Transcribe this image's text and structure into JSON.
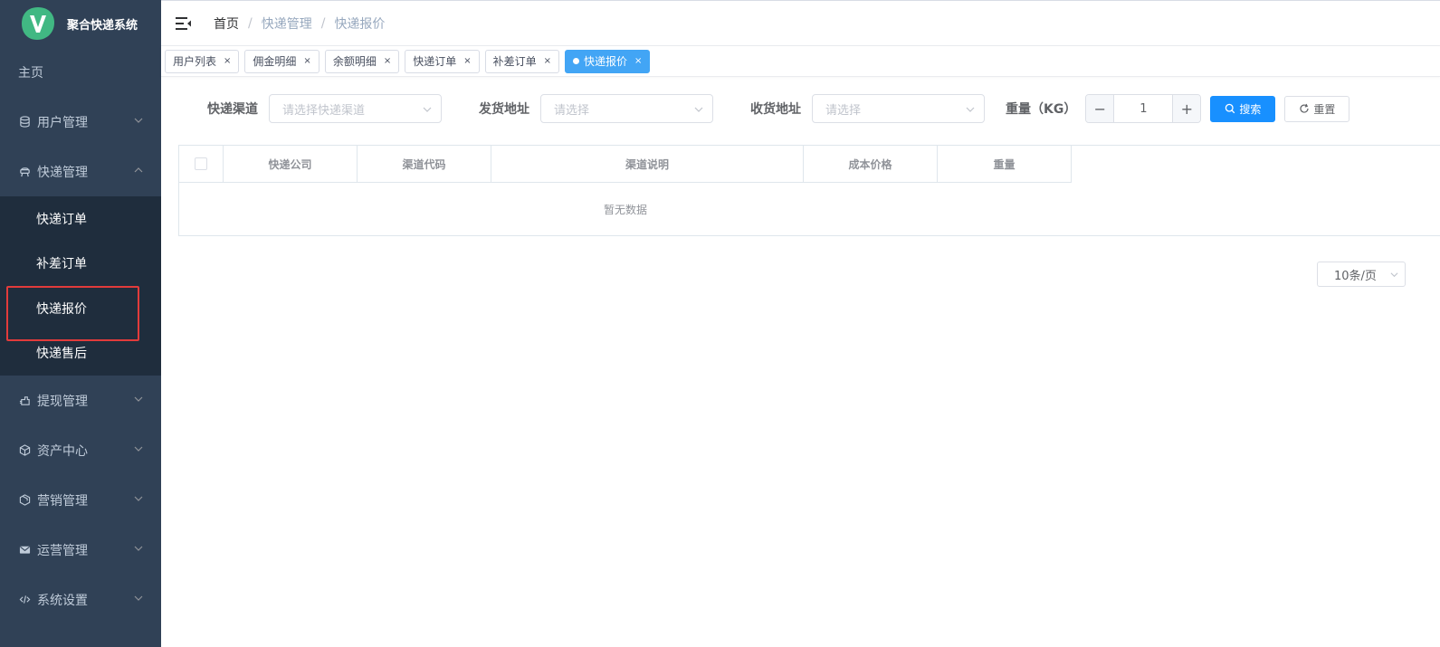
{
  "app": {
    "title": "聚合快递系统",
    "logo_letter": "V",
    "logo_color": "#41b883"
  },
  "sidebar": {
    "home": "主页",
    "items": [
      {
        "label": "用户管理",
        "icon": "database-icon"
      },
      {
        "label": "快递管理",
        "icon": "courier-icon",
        "expanded": true
      },
      {
        "label": "提现管理",
        "icon": "withdraw-icon"
      },
      {
        "label": "资产中心",
        "icon": "cube-icon"
      },
      {
        "label": "营销管理",
        "icon": "box-icon"
      },
      {
        "label": "运营管理",
        "icon": "mail-icon"
      },
      {
        "label": "系统设置",
        "icon": "code-icon"
      }
    ],
    "sub_items": [
      {
        "label": "快递订单"
      },
      {
        "label": "补差订单"
      },
      {
        "label": "快递报价",
        "active": true
      },
      {
        "label": "快递售后"
      }
    ],
    "bg_color": "#304156",
    "sub_bg_color": "#1f2d3d",
    "highlight_color": "#e23b3b"
  },
  "breadcrumb": [
    "首页",
    "快递管理",
    "快递报价"
  ],
  "tags": [
    {
      "label": "用户列表"
    },
    {
      "label": "佣金明细"
    },
    {
      "label": "余额明细"
    },
    {
      "label": "快递订单"
    },
    {
      "label": "补差订单"
    },
    {
      "label": "快递报价",
      "active": true
    }
  ],
  "filters": {
    "channel_label": "快递渠道",
    "channel_placeholder": "请选择快递渠道",
    "from_label": "发货地址",
    "from_placeholder": "请选择",
    "to_label": "收货地址",
    "to_placeholder": "请选择",
    "weight_label": "重量（KG）",
    "weight_value": "1",
    "search_label": "搜索",
    "reset_label": "重置"
  },
  "table": {
    "columns": [
      "快递公司",
      "渠道代码",
      "渠道说明",
      "成本价格",
      "重量"
    ],
    "empty_text": "暂无数据"
  },
  "pagination": {
    "page_size": "10条/页"
  },
  "colors": {
    "primary": "#1890ff",
    "active_tag": "#42a5f5"
  }
}
